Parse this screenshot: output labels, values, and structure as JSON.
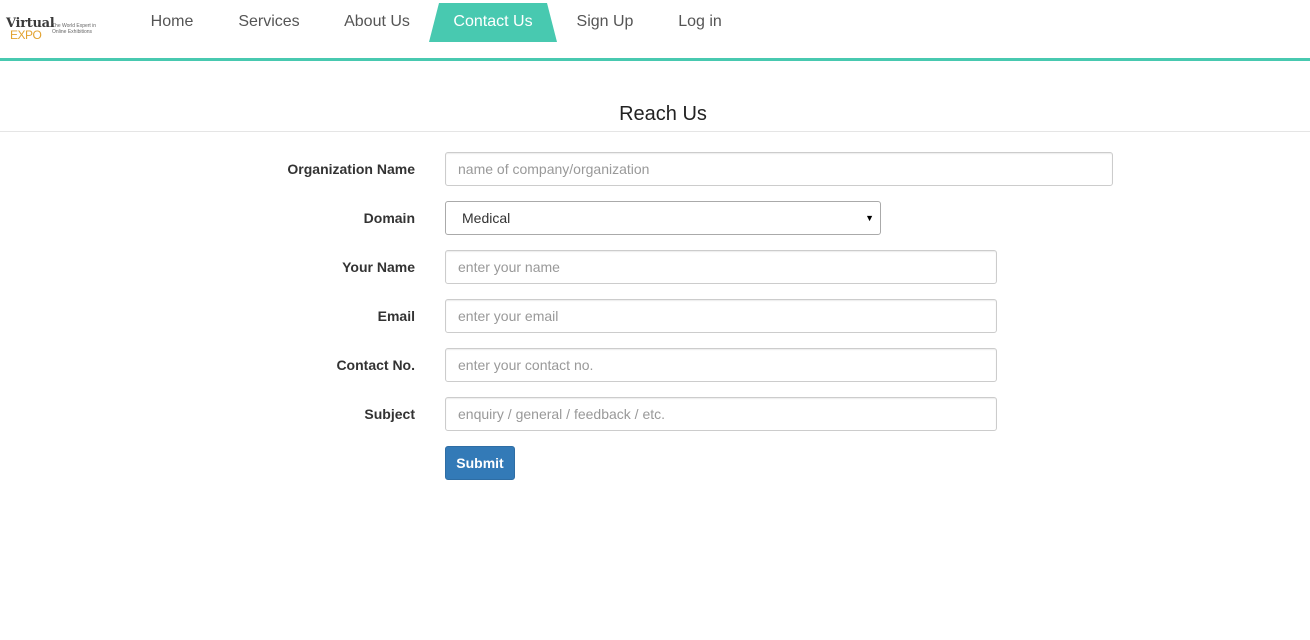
{
  "brand": {
    "logo_top": "Virtual",
    "logo_bottom": "EXPO",
    "tagline": "The World Expert in Online Exhibitions",
    "accent_color": "#48c9b0"
  },
  "nav": {
    "items": [
      {
        "label": "Home"
      },
      {
        "label": "Services"
      },
      {
        "label": "About Us"
      },
      {
        "label": "Contact Us",
        "active": true
      },
      {
        "label": "Sign Up"
      },
      {
        "label": "Log in"
      }
    ]
  },
  "page": {
    "title": "Reach Us"
  },
  "form": {
    "organization": {
      "label": "Organization Name",
      "placeholder": "name of company/organization",
      "value": ""
    },
    "domain": {
      "label": "Domain",
      "selected": "Medical"
    },
    "name": {
      "label": "Your Name",
      "placeholder": "enter your name",
      "value": ""
    },
    "email": {
      "label": "Email",
      "placeholder": "enter your email",
      "value": ""
    },
    "contact": {
      "label": "Contact No.",
      "placeholder": "enter your contact no.",
      "value": ""
    },
    "subject": {
      "label": "Subject",
      "placeholder": "enquiry / general / feedback / etc.",
      "value": ""
    },
    "submit_label": "Submit",
    "submit_color": "#337ab7"
  }
}
